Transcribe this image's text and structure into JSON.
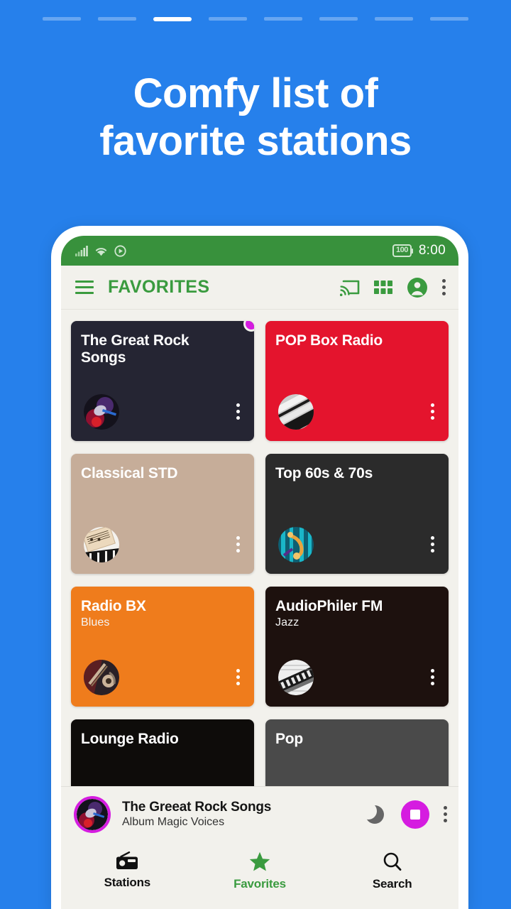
{
  "pager": {
    "total": 8,
    "active_index": 2
  },
  "headline": {
    "line1": "Comfy list of",
    "line2": "favorite stations"
  },
  "colors": {
    "background_blue": "#2680eb",
    "status_bar_green": "#38913c",
    "brand_green": "#3a9b3f",
    "accent_magenta": "#d51ce0",
    "screen_bg": "#f2f1ec"
  },
  "status_bar": {
    "signal_icon": "signal-bars-icon",
    "wifi_icon": "wifi-icon",
    "play_icon": "play-circle-icon",
    "battery_level": "100",
    "time": "8:00"
  },
  "toolbar": {
    "menu_icon": "hamburger-menu-icon",
    "title": "FAVORITES",
    "cast_icon": "cast-icon",
    "grid_icon": "grid-view-icon",
    "account_icon": "account-circle-icon",
    "overflow_icon": "more-vertical-icon"
  },
  "stations": [
    {
      "title": "The Great Rock Songs",
      "subtitle": "",
      "bg": "#252533",
      "text": "#ffffff",
      "art": "microphone-art",
      "badge": "#d51ce0",
      "has_badge": true
    },
    {
      "title": "POP Box Radio",
      "subtitle": "",
      "bg": "#e4142d",
      "text": "#ffffff",
      "art": "piano-keys-art",
      "badge": "",
      "has_badge": false
    },
    {
      "title": "Classical STD",
      "subtitle": "",
      "bg": "#c6ad99",
      "text": "#ffffff",
      "art": "sheet-music-art",
      "badge": "",
      "has_badge": false
    },
    {
      "title": "Top 60s & 70s",
      "subtitle": "",
      "bg": "#2b2b2b",
      "text": "#ffffff",
      "art": "saxophone-art",
      "badge": "",
      "has_badge": false
    },
    {
      "title": "Radio BX",
      "subtitle": "Blues",
      "bg": "#ef7c1c",
      "text": "#ffffff",
      "art": "guitar-art",
      "badge": "",
      "has_badge": false
    },
    {
      "title": "AudioPhiler FM",
      "subtitle": "Jazz",
      "bg": "#1d110e",
      "text": "#ffffff",
      "art": "vintage-radio-art",
      "badge": "",
      "has_badge": false
    },
    {
      "title": "Lounge Radio",
      "subtitle": "",
      "bg": "#0e0c0a",
      "text": "#ffffff",
      "art": "",
      "badge": "",
      "has_badge": false
    },
    {
      "title": "Pop",
      "subtitle": "",
      "bg": "#4a4a4a",
      "text": "#ffffff",
      "art": "",
      "badge": "",
      "has_badge": false
    }
  ],
  "player": {
    "art": "microphone-art",
    "title": "The Greeat Rock Songs",
    "subtitle": "Album Magic Voices",
    "sleep_icon": "moon-sleep-icon",
    "stop_icon": "stop-icon",
    "overflow_icon": "more-vertical-icon"
  },
  "bottom_nav": {
    "items": [
      {
        "label": "Stations",
        "icon": "radio-icon",
        "active": false
      },
      {
        "label": "Favorites",
        "icon": "star-icon",
        "active": true
      },
      {
        "label": "Search",
        "icon": "search-icon",
        "active": false
      }
    ]
  }
}
